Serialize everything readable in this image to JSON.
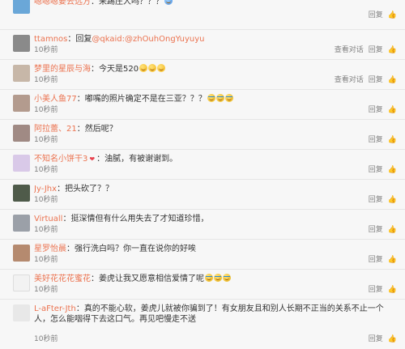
{
  "actions": {
    "reply": "回复",
    "view_conversation": "查看对话"
  },
  "comments": [
    {
      "user": "嗯嗯嗯要去远方",
      "sep": "：",
      "text": "来踢庄人吗？？？",
      "time": "",
      "has_conversation": false,
      "avatar_color": "#6aa7d8"
    },
    {
      "user": "ttamnos",
      "sep": "：",
      "prefix": "回复",
      "mention": "@qkaid:@zhOuhOngYuyuyu",
      "text": "",
      "time": "10秒前",
      "has_conversation": true,
      "avatar_color": "#8a8a8a"
    },
    {
      "user": "梦里的星辰与海",
      "sep": "：",
      "text": "今天是520",
      "time": "10秒前",
      "has_conversation": true,
      "avatar_color": "#c7b7a8"
    },
    {
      "user": "小美人鱼77",
      "sep": "：",
      "text": "嘟嘴的照片确定不是在三亚？？？",
      "time": "10秒前",
      "has_conversation": false,
      "avatar_color": "#b39b8e"
    },
    {
      "user": "阿拉蕾、21",
      "sep": "：",
      "text": "然后呢？",
      "time": "10秒前",
      "has_conversation": false,
      "avatar_color": "#a08a84"
    },
    {
      "user": "不知名小饼干3",
      "sep": "：",
      "text": "油腻，有被谢谢到。",
      "time": "10秒前",
      "has_conversation": false,
      "avatar_color": "#d9c9e8"
    },
    {
      "user": "Jy-Jhx",
      "sep": "：",
      "text": "把头砍了？？",
      "time": "10秒前",
      "has_conversation": false,
      "avatar_color": "#4f5b4a"
    },
    {
      "user": "Virtuall",
      "sep": "：",
      "text": "挺深情但有什么用失去了才知道珍惜，",
      "time": "10秒前",
      "has_conversation": false,
      "avatar_color": "#9ba0a8"
    },
    {
      "user": "星罗怡晨",
      "sep": "：",
      "text": "强行洗白吗？你一直在说你的好唉",
      "time": "10秒前",
      "has_conversation": false,
      "avatar_color": "#b58a6f"
    },
    {
      "user": "美好花花花蜜花",
      "sep": "：",
      "text": "姜虎让我又愿意相信爱情了呢",
      "time": "10秒前",
      "has_conversation": false,
      "avatar_color": "#f2f2f2"
    },
    {
      "user": "L-aFter-Jth",
      "sep": "：",
      "text": "真的不能心软，姜虎儿就被你骗到了！有女朋友且和别人长期不正当的关系不止一个人，怎么能咽得下去这口气。再见吧慢走不送",
      "time": "10秒前",
      "has_conversation": false,
      "avatar_color": "#e8e8e8"
    }
  ]
}
